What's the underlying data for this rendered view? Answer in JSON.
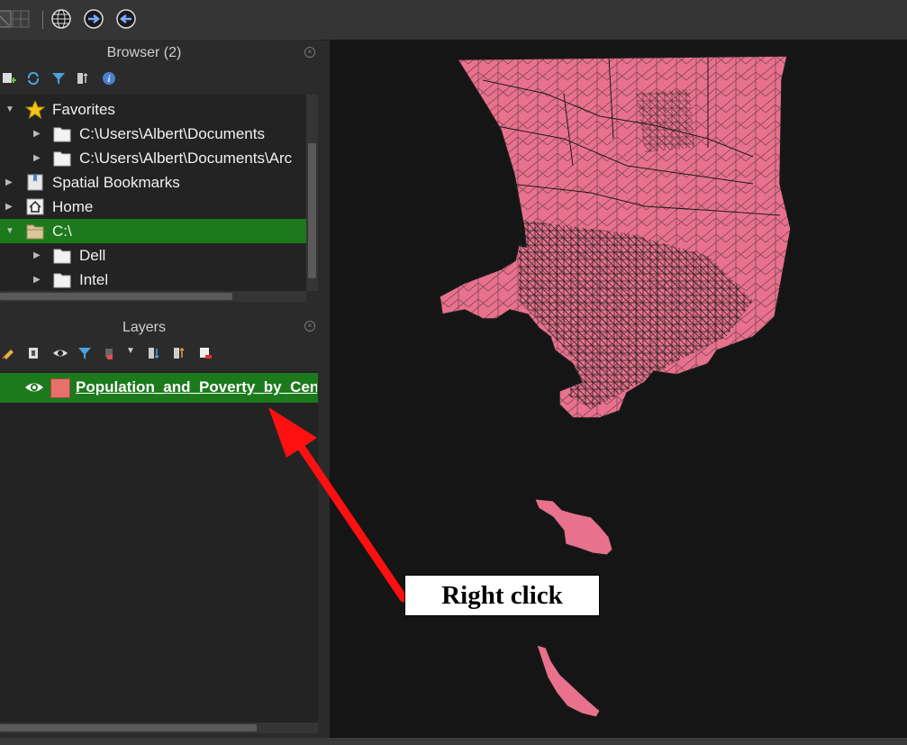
{
  "toolbar": {
    "buttons": [
      "grid-icon",
      "globe-icon",
      "forward-globe-icon",
      "back-globe-icon"
    ]
  },
  "browser": {
    "title": "Browser (2)",
    "tools": [
      "add-layer-icon",
      "refresh-icon",
      "filter-icon",
      "collapse-icon",
      "info-icon"
    ],
    "items": [
      {
        "label": "Favorites",
        "icon": "star-icon",
        "expanded": true
      },
      {
        "label": "C:\\Users\\Albert\\Documents",
        "icon": "folder-icon"
      },
      {
        "label": "C:\\Users\\Albert\\Documents\\Arc",
        "icon": "folder-icon"
      },
      {
        "label": "Spatial Bookmarks",
        "icon": "bookmark-icon"
      },
      {
        "label": "Home",
        "icon": "home-icon"
      },
      {
        "label": "C:\\",
        "icon": "drive-folder-icon",
        "selected": true,
        "expanded": true
      },
      {
        "label": "Dell",
        "icon": "folder-icon"
      },
      {
        "label": "Intel",
        "icon": "folder-icon"
      }
    ]
  },
  "layers": {
    "title": "Layers",
    "tools": [
      "style-icon",
      "add-group-icon",
      "visibility-icon",
      "filter-icon",
      "filter-expression-icon",
      "dropdown-icon",
      "expand-icon",
      "collapse-icon",
      "remove-layer-icon"
    ],
    "items": [
      {
        "label": "Population_and_Poverty_by_Cen",
        "visible": true,
        "swatch_color": "#e8706a"
      }
    ]
  },
  "map": {
    "fill_color": "#e8718d",
    "stroke_color": "#1a1a1a",
    "background": "#151515"
  },
  "annotation": {
    "label": "Right click",
    "arrow_color": "#ff1010"
  },
  "colors": {
    "selection": "#1c7a1c",
    "panel_bg": "#2b2b2b"
  }
}
